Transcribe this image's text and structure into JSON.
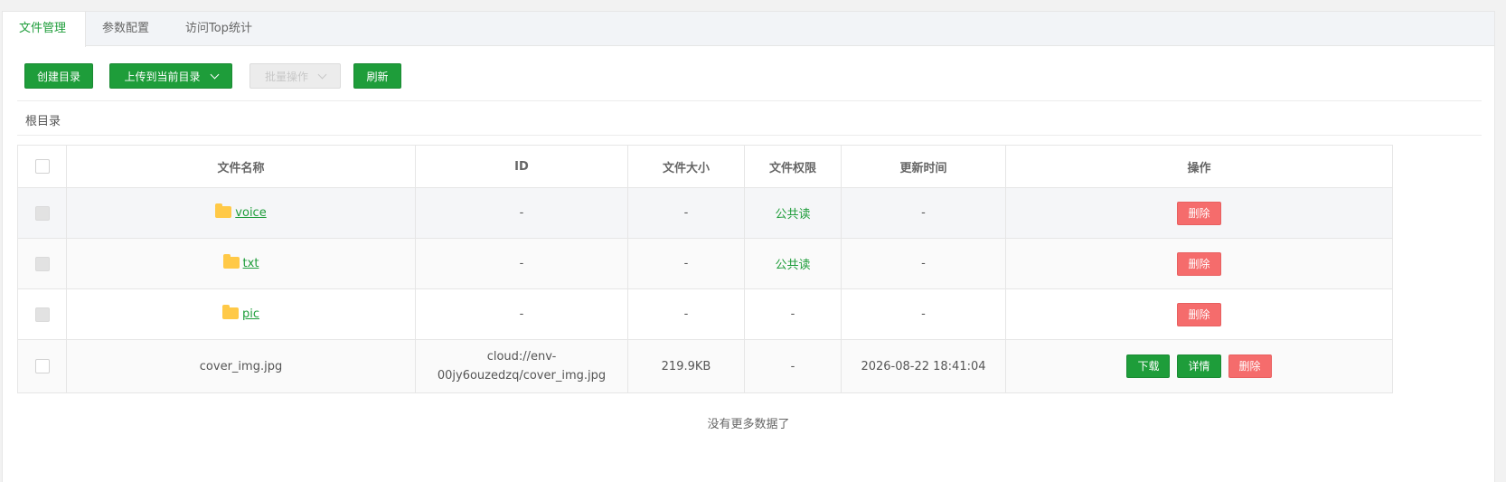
{
  "tabs": [
    {
      "label": "文件管理",
      "active": true
    },
    {
      "label": "参数配置",
      "active": false
    },
    {
      "label": "访问Top统计",
      "active": false
    }
  ],
  "toolbar": {
    "create_dir": "创建目录",
    "upload": "上传到当前目录",
    "batch": "批量操作",
    "refresh": "刷新"
  },
  "breadcrumb": "根目录",
  "table": {
    "headers": [
      "文件名称",
      "ID",
      "文件大小",
      "文件权限",
      "更新时间",
      "操作"
    ],
    "rows": [
      {
        "name": "voice",
        "type": "folder",
        "id": "-",
        "size": "-",
        "perm": "公共读",
        "updated": "-",
        "actions": [
          "删除"
        ]
      },
      {
        "name": "txt",
        "type": "folder",
        "id": "-",
        "size": "-",
        "perm": "公共读",
        "updated": "-",
        "actions": [
          "删除"
        ]
      },
      {
        "name": "pic",
        "type": "folder",
        "id": "-",
        "size": "-",
        "perm": "-",
        "updated": "-",
        "actions": [
          "删除"
        ]
      },
      {
        "name": "cover_img.jpg",
        "type": "file",
        "id_line1": "cloud://env-",
        "id_line2": "00jy6ouzedzq/cover_img.jpg",
        "size": "219.9KB",
        "perm": "-",
        "updated": "2026-08-22 18:41:04",
        "actions": [
          "下载",
          "详情",
          "删除"
        ]
      }
    ]
  },
  "footer": "没有更多数据了",
  "colors": {
    "primary": "#1e9d3a",
    "danger": "#f56c6c",
    "folder": "#ffc947"
  }
}
